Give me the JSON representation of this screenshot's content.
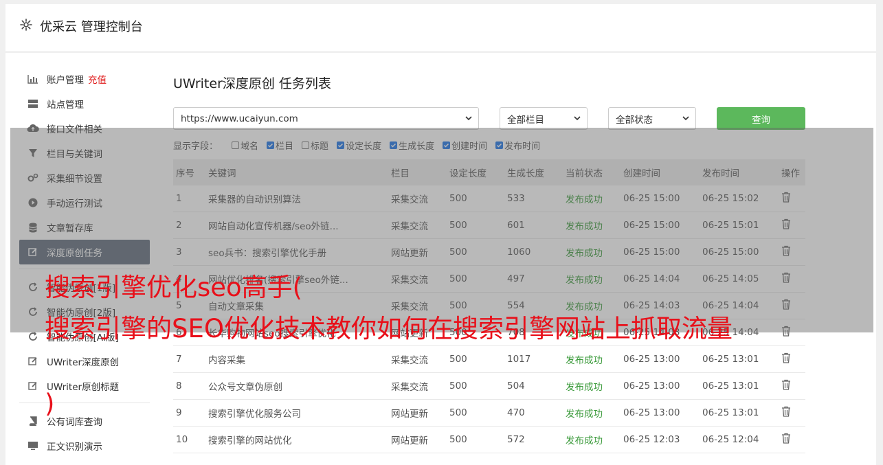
{
  "header": {
    "brand": "优采云 管理控制台"
  },
  "sidebar": {
    "items": [
      {
        "label": "账户管理",
        "extra": "充值",
        "icon": "bar-chart-icon"
      },
      {
        "label": "站点管理",
        "icon": "server-icon"
      },
      {
        "label": "接口文件相关",
        "icon": "cloud-upload-icon"
      },
      {
        "label": "栏目与关键词",
        "icon": "filter-icon"
      },
      {
        "label": "采集细节设置",
        "icon": "gears-icon"
      },
      {
        "label": "手动运行测试",
        "icon": "play-circle-icon"
      },
      {
        "label": "文章暂存库",
        "icon": "database-icon"
      },
      {
        "label": "深度原创任务",
        "icon": "edit-icon"
      },
      {
        "label": "智能伪原创[1版]",
        "icon": "refresh-icon"
      },
      {
        "label": "智能伪原创[2版]",
        "icon": "refresh-icon"
      },
      {
        "label": "智能伪原创[AI版]",
        "icon": "refresh-icon"
      },
      {
        "label": "UWriter深度原创",
        "icon": "edit-icon"
      },
      {
        "label": "UWriter原创标题",
        "icon": "edit-icon"
      },
      {
        "label": "公有词库查询",
        "icon": "book-icon"
      },
      {
        "label": "正文识别演示",
        "icon": "monitor-icon"
      }
    ]
  },
  "main": {
    "title": "UWriter深度原创 任务列表",
    "site_select": "https://www.ucaiyun.com",
    "column_select": "全部栏目",
    "status_select": "全部状态",
    "query_label": "查询",
    "fields_label": "显示字段：",
    "fields": [
      {
        "label": "域名",
        "checked": false
      },
      {
        "label": "栏目",
        "checked": true
      },
      {
        "label": "标题",
        "checked": false
      },
      {
        "label": "设定长度",
        "checked": true
      },
      {
        "label": "生成长度",
        "checked": true
      },
      {
        "label": "创建时间",
        "checked": true
      },
      {
        "label": "发布时间",
        "checked": true
      }
    ],
    "table": {
      "headers": [
        "序号",
        "关键词",
        "栏目",
        "设定长度",
        "生成长度",
        "当前状态",
        "创建时间",
        "发布时间",
        "操作"
      ],
      "rows": [
        [
          "1",
          "采集器的自动识别算法",
          "采集交流",
          "500",
          "533",
          "发布成功",
          "06-25 15:00",
          "06-25 15:02"
        ],
        [
          "2",
          "网站自动化宣传机器/seo外链...",
          "采集交流",
          "500",
          "601",
          "发布成功",
          "06-25 15:00",
          "06-25 15:01"
        ],
        [
          "3",
          "seo兵书：搜索引擎优化手册",
          "网站更新",
          "500",
          "1060",
          "发布成功",
          "06-25 15:00",
          "06-25 15:00"
        ],
        [
          "4",
          "网站优化排名(搜索引擎seo外链...",
          "采集交流",
          "500",
          "497",
          "发布成功",
          "06-25 14:04",
          "06-25 14:05"
        ],
        [
          "5",
          "自动文章采集",
          "采集交流",
          "500",
          "554",
          "发布成功",
          "06-25 14:03",
          "06-25 14:04"
        ],
        [
          "6",
          "长华购物网站seo搜索引擎优化",
          "网站更新",
          "500",
          "708",
          "发布成功",
          "06-25 14:03",
          "06-25 14:04"
        ],
        [
          "7",
          "内容采集",
          "采集交流",
          "500",
          "1017",
          "发布成功",
          "06-25 13:00",
          "06-25 13:01"
        ],
        [
          "8",
          "公众号文章伪原创",
          "采集交流",
          "500",
          "504",
          "发布成功",
          "06-25 13:00",
          "06-25 13:01"
        ],
        [
          "9",
          "搜索引擎优化服务公司",
          "网站更新",
          "500",
          "470",
          "发布成功",
          "06-25 13:00",
          "06-25 13:01"
        ],
        [
          "10",
          "搜索引擎的网站优化",
          "网站更新",
          "500",
          "572",
          "发布成功",
          "06-25 12:03",
          "06-25 12:04"
        ]
      ]
    }
  },
  "overlay": {
    "line1": "搜索引擎优化seo高手(",
    "line2": "搜索引擎的SEO优化技术教你如何在搜索引擎网站上抓取流量",
    "line3": ")"
  },
  "colors": {
    "accent_green": "#5cb85c",
    "active_nav": "#5f6b7a",
    "headline_red": "#e8101a",
    "status_green": "#3a9a3a"
  }
}
